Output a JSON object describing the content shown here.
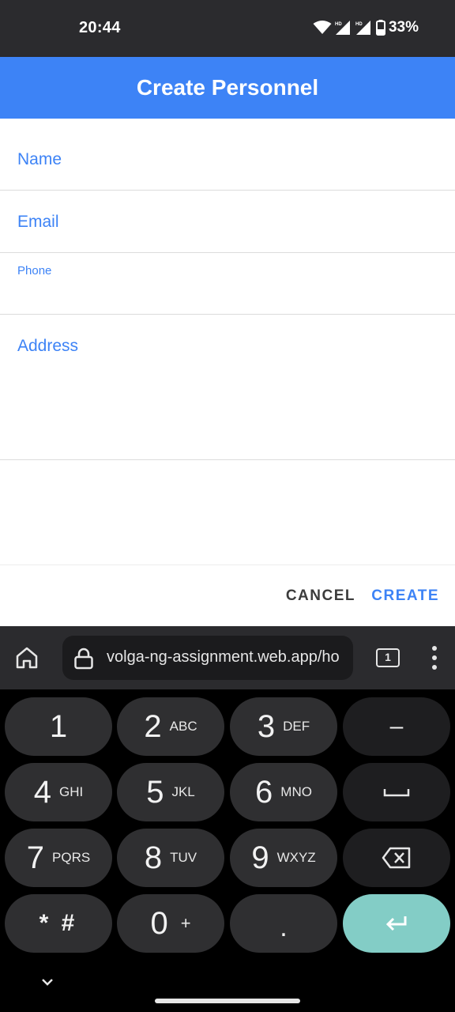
{
  "status_bar": {
    "time": "20:44",
    "battery": "33%",
    "icons": [
      "wifi-icon",
      "signal-icon",
      "signal-icon",
      "battery-icon"
    ]
  },
  "header": {
    "title": "Create Personnel"
  },
  "form": {
    "fields": [
      {
        "label": "Name",
        "value": ""
      },
      {
        "label": "Email",
        "value": ""
      },
      {
        "label": "Phone",
        "value": ""
      },
      {
        "label": "Address",
        "value": ""
      }
    ]
  },
  "actions": {
    "cancel_label": "CANCEL",
    "create_label": "CREATE"
  },
  "browser": {
    "url": "volga-ng-assignment.web.app/ho",
    "tab_count": "1",
    "icons": [
      "home-icon",
      "lock-icon",
      "tabs-icon",
      "more-vert-icon"
    ]
  },
  "keyboard": {
    "keys": [
      {
        "main": "1",
        "sub": ""
      },
      {
        "main": "2",
        "sub": "ABC"
      },
      {
        "main": "3",
        "sub": "DEF"
      },
      {
        "main": "–",
        "sub": ""
      },
      {
        "main": "4",
        "sub": "GHI"
      },
      {
        "main": "5",
        "sub": "JKL"
      },
      {
        "main": "6",
        "sub": "MNO"
      },
      {
        "main": "",
        "sub": "",
        "icon": "space-icon"
      },
      {
        "main": "7",
        "sub": "PQRS"
      },
      {
        "main": "8",
        "sub": "TUV"
      },
      {
        "main": "9",
        "sub": "WXYZ"
      },
      {
        "main": "",
        "sub": "",
        "icon": "backspace-icon"
      },
      {
        "main": "* #",
        "sub": ""
      },
      {
        "main": "0",
        "sub": "+"
      },
      {
        "main": ".",
        "sub": ""
      },
      {
        "main": "",
        "sub": "",
        "icon": "enter-icon"
      }
    ],
    "enter_color": "#83cdc6"
  },
  "colors": {
    "primary": "#3d83f6",
    "status_bar": "#2b2b2e"
  }
}
